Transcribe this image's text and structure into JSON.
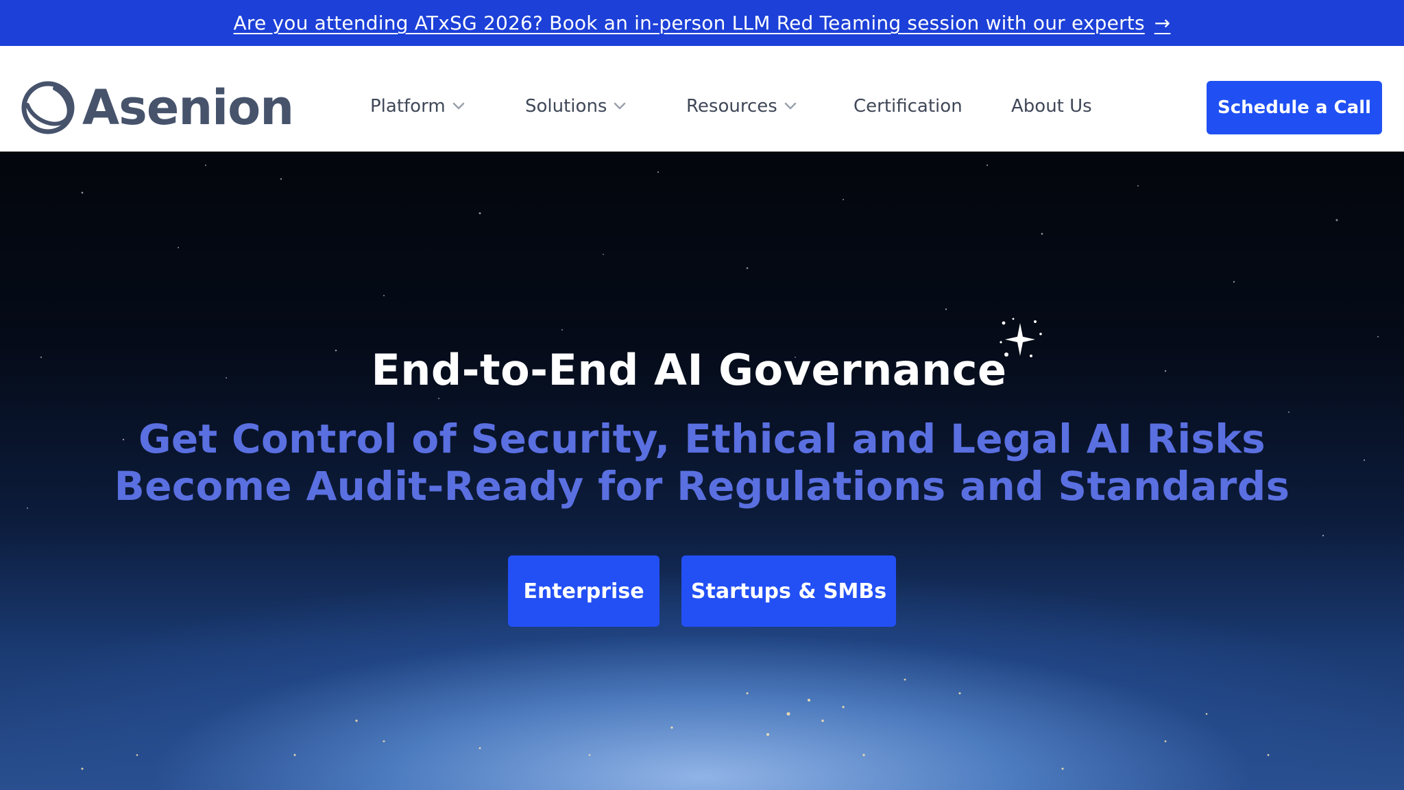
{
  "announcement": {
    "text": "Are you attending ATxSG 2026? Book an in-person LLM Red Teaming session with our experts",
    "arrow": "→"
  },
  "header": {
    "logo_text": "Asenion",
    "nav": [
      {
        "label": "Platform",
        "has_dropdown": true
      },
      {
        "label": "Solutions",
        "has_dropdown": true
      },
      {
        "label": "Resources",
        "has_dropdown": true
      },
      {
        "label": "Certification",
        "has_dropdown": false
      },
      {
        "label": "About Us",
        "has_dropdown": false
      }
    ],
    "cta_label": "Schedule a Call"
  },
  "hero": {
    "title": "End-to-End AI Governance",
    "subtitle_line1": "Get Control of Security, Ethical and Legal AI Risks",
    "subtitle_line2": "Become Audit-Ready for Regulations and Standards",
    "buttons": [
      {
        "label": "Enterprise"
      },
      {
        "label": "Startups & SMBs"
      }
    ]
  },
  "colors": {
    "announcement_bg": "#1c40d8",
    "accent": "#2050f3",
    "logo": "#46536b",
    "subtitle": "#5a6fe0"
  },
  "icons": {
    "logo_mark": "globe-ring-icon",
    "nav_chevron": "chevron-down-icon",
    "title_decoration": "sparkle-icon"
  }
}
